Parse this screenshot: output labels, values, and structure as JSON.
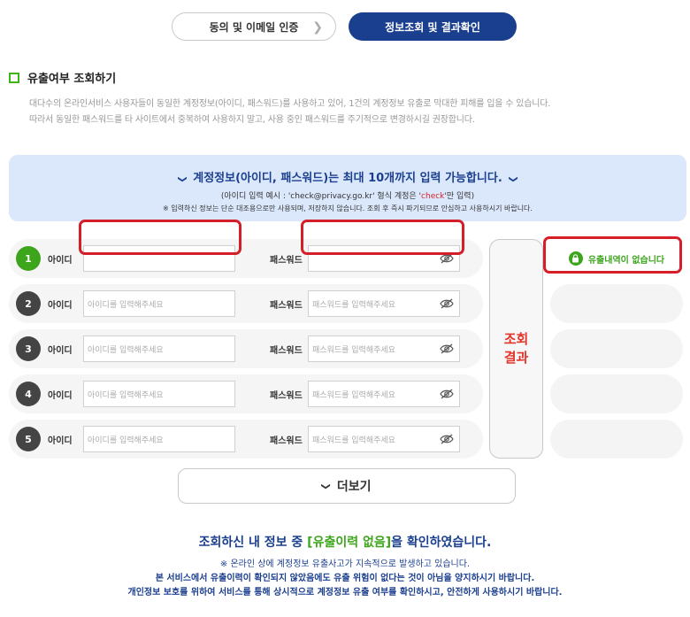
{
  "steps": {
    "step1_label": "동의 및 이메일 인증",
    "step2_label": "정보조회 및 결과확인"
  },
  "section": {
    "title": "유출여부 조회하기",
    "desc_line1": "대다수의 온라인서비스 사용자들이 동일한 계정정보(아이디, 패스워드)를 사용하고 있어, 1건의 계정정보 유출로 막대한 피해를 입을 수 있습니다.",
    "desc_line2": "따라서 동일한 패스워드를 타 사이트에서 중복하여 사용하지 말고, 사용 중인 패스워드를 주기적으로 변경하시길 권장합니다."
  },
  "notice": {
    "title": "계정정보(아이디, 패스워드)는 최대 10개까지 입력 가능합니다.",
    "sub_prefix": "(아이디 입력 예시 : 'check@privacy.go.kr' 형식 계정은 '",
    "sub_red": "check",
    "sub_suffix": "'만 입력)",
    "note": "※ 입력하신 정보는 단순 대조용으로만 사용되며, 저장하지 않습니다. 조회 후 즉시 파기되므로 안심하고 사용하시기 바랍니다."
  },
  "form": {
    "id_label": "아이디",
    "pw_label": "패스워드",
    "id_placeholder": "아이디를 입력해주세요",
    "pw_placeholder": "패스워드를 입력해주세요",
    "rows": [
      {
        "num": "1",
        "id_value": "",
        "pw_value": ""
      },
      {
        "num": "2",
        "id_value": "",
        "pw_value": ""
      },
      {
        "num": "3",
        "id_value": "",
        "pw_value": ""
      },
      {
        "num": "4",
        "id_value": "",
        "pw_value": ""
      },
      {
        "num": "5",
        "id_value": "",
        "pw_value": ""
      }
    ]
  },
  "search_button": {
    "line1": "조회",
    "line2": "결과"
  },
  "result": {
    "row1": "유출내역이 없습니다"
  },
  "more_label": "더보기",
  "summary": {
    "prefix": "조회하신 내 정보 중 ",
    "highlight": "[유출이력 없음]",
    "suffix": "을 확인하였습니다."
  },
  "footer": {
    "line1": "※ 온라인 상에 계정정보 유출사고가 지속적으로 발생하고 있습니다.",
    "line2": "본 서비스에서 유출이력이 확인되지 않았음에도 유출 위험이 없다는 것이 아님을 양지하시기 바랍니다.",
    "line3": "개인정보 보호를 위하여 서비스를 통해 상시적으로 계정정보 유출 여부를 확인하시고, 안전하게 사용하시기 바랍니다."
  },
  "colors": {
    "brand_navy": "#1b3f8f",
    "success_green": "#3da51c",
    "alert_red": "#d41e2a"
  }
}
